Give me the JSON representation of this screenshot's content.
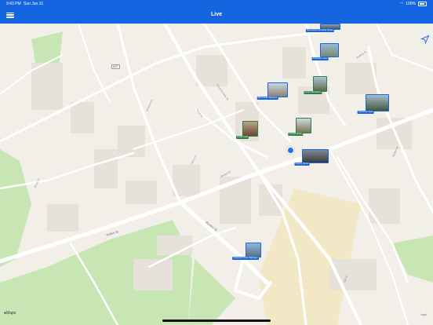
{
  "status_bar": {
    "time": "9:43 PM",
    "date": "Sun Jan 31",
    "battery": "100%"
  },
  "nav": {
    "title": "Live"
  },
  "map": {
    "provider": "Maps",
    "legal": "Legal",
    "route_shield": "M27",
    "streets": [
      {
        "name": "Pollen St"
      },
      {
        "name": "Buxton St"
      },
      {
        "name": "Blossom St"
      },
      {
        "name": "Hood St"
      },
      {
        "name": "Great Ancoats St"
      },
      {
        "name": "Henry St"
      },
      {
        "name": "Bengal St"
      },
      {
        "name": "Jersey St"
      },
      {
        "name": "Mill St"
      },
      {
        "name": "Redhill St"
      },
      {
        "name": "Rodney St"
      }
    ],
    "cameras": [
      {
        "label": "Manchester Piccadilly Station",
        "style": "blue"
      },
      {
        "label": "Interactive Sites",
        "style": "blue"
      },
      {
        "label": "Gorton Monastery",
        "style": "green"
      },
      {
        "label": "Manchester Museum",
        "style": "blue"
      },
      {
        "label": "Interactive Sites",
        "style": "blue"
      },
      {
        "label": "Central Library",
        "style": "green"
      },
      {
        "label": "Castle Field",
        "style": "green"
      },
      {
        "label": "Factory Works",
        "style": "blue"
      },
      {
        "label": "Chatsworth Park Walkways",
        "style": "blue"
      }
    ],
    "colors": {
      "nav": "#1565e0",
      "park": "#c8e6b4",
      "road": "#ffffff",
      "land": "#f2efe9",
      "building": "#e6e1d9",
      "yellow_zone": "#f3e8c6"
    }
  }
}
